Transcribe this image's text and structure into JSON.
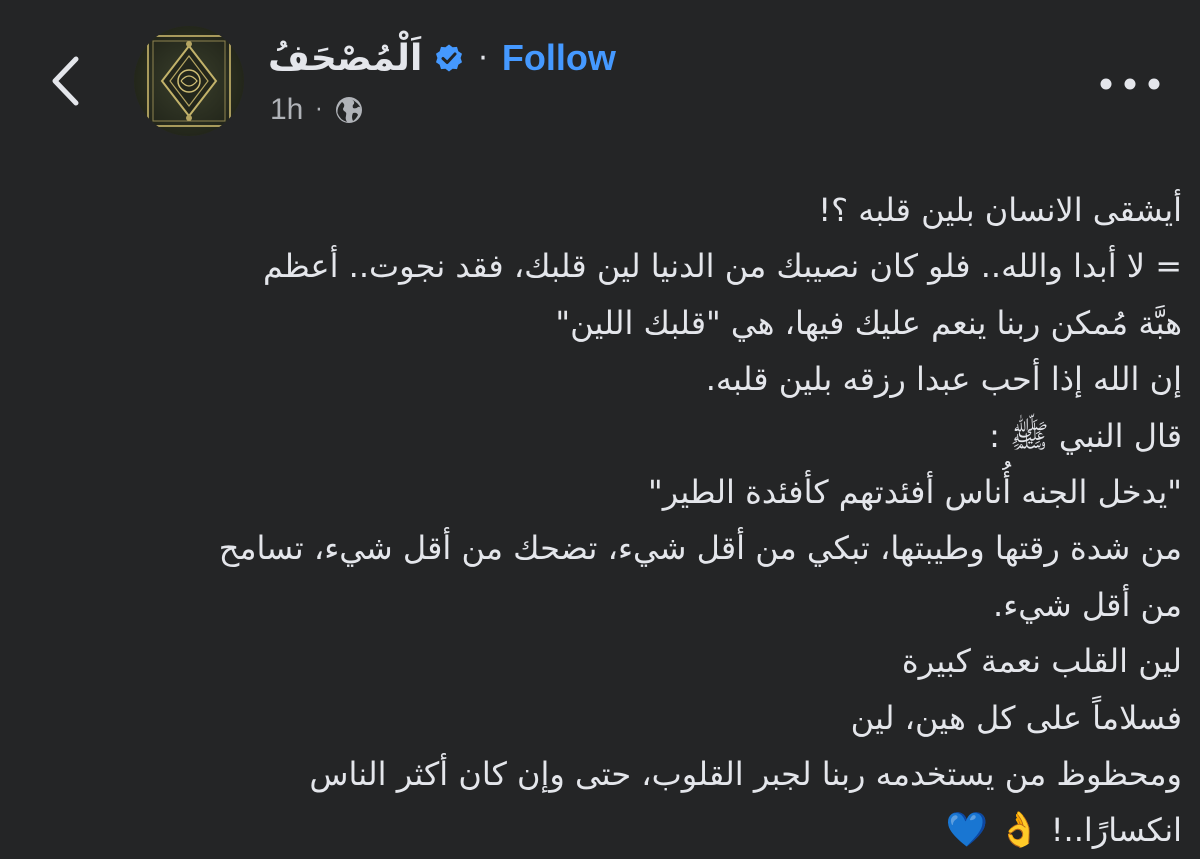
{
  "colors": {
    "background": "#242526",
    "text": "#e4e6eb",
    "secondary_text": "#b0b3b8",
    "accent": "#4599ff",
    "verified_badge": "#4599ff"
  },
  "header": {
    "page_name": "اَلْمُصْحَفُ",
    "separator": "·",
    "follow_label": "Follow",
    "time": "1h",
    "meta_separator": "·",
    "audience_icon": "globe-icon",
    "back_icon": "chevron-left-icon",
    "more_icon": "more-horizontal-icon"
  },
  "post": {
    "lines": [
      "أيشقى الانسان بلين قلبه ؟!",
      "= لا أبدا والله.. فلو كان نصيبك من الدنيا لين قلبك، فقد نجوت.. أعظم",
      "هبَّة مُمكن ربنا ينعم عليك فيها، هي \"قلبك اللين\"",
      "إن الله إذا أحب عبدا رزقه بلين قلبه.",
      "قال النبي ﷺ :",
      "\"يدخل الجنه أُناس أفئدتهم كأفئدة الطير\"",
      "من شدة رقتها وطيبتها، تبكي من أقل شيء، تضحك من أقل شيء، تسامح",
      "من أقل شيء.",
      "لين القلب نعمة كبيرة",
      "فسلاماً على كل هين، لين",
      "ومحظوظ من يستخدمه ربنا لجبر القلوب، حتى وإن كان أكثر الناس",
      "انكسارًا..!"
    ],
    "emojis": [
      "👌",
      "💙"
    ]
  }
}
